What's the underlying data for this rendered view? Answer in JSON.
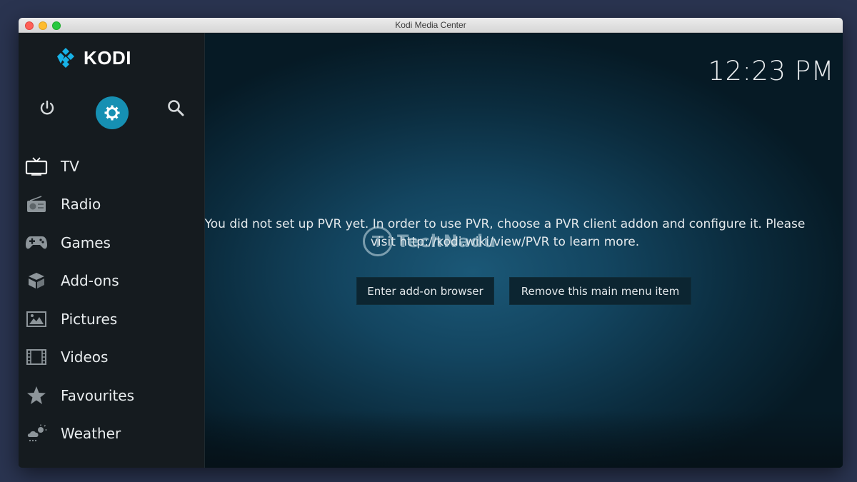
{
  "window": {
    "title": "Kodi Media Center"
  },
  "sidebar": {
    "logo_text": "KODI",
    "top_buttons": [
      {
        "name": "power",
        "icon": "power-icon"
      },
      {
        "name": "settings",
        "icon": "gear-icon"
      },
      {
        "name": "search",
        "icon": "search-icon"
      }
    ],
    "menu": [
      {
        "label": "TV",
        "icon": "tv-icon"
      },
      {
        "label": "Radio",
        "icon": "radio-icon"
      },
      {
        "label": "Games",
        "icon": "gamepad-icon"
      },
      {
        "label": "Add-ons",
        "icon": "box-icon"
      },
      {
        "label": "Pictures",
        "icon": "picture-icon"
      },
      {
        "label": "Videos",
        "icon": "film-icon"
      },
      {
        "label": "Favourites",
        "icon": "star-icon"
      },
      {
        "label": "Weather",
        "icon": "weather-icon"
      }
    ]
  },
  "main": {
    "clock": "12:23 PM",
    "message": "You did not set up PVR yet. In order to use PVR, choose a PVR client addon and configure it. Please visit http://kodi.wiki/view/PVR to learn more.",
    "buttons": {
      "addon_browser": "Enter add-on browser",
      "remove_item": "Remove this main menu item"
    },
    "watermark": "TechNadu"
  },
  "colors": {
    "accent": "#1690b3",
    "sidebar_bg": "#151b1f",
    "main_bg": "#134560"
  }
}
